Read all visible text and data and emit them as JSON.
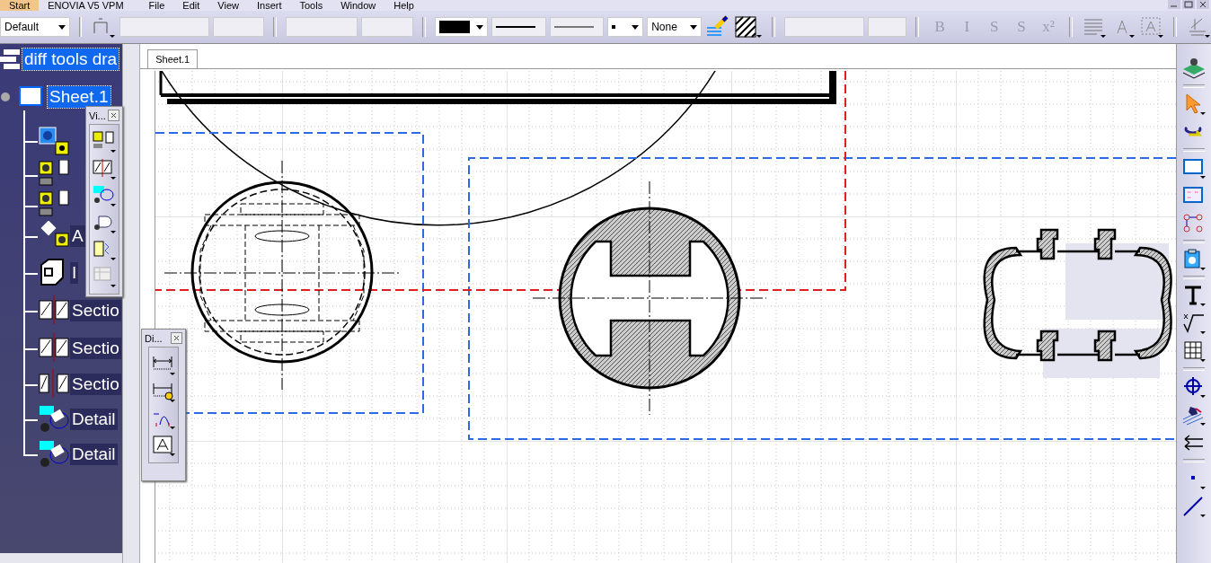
{
  "menu_bar": [
    {
      "label": "Start",
      "selected": true
    },
    {
      "label": "ENOVIA V5 VPM",
      "selected": false
    },
    {
      "label": "File",
      "selected": false
    },
    {
      "label": "Edit",
      "selected": false
    },
    {
      "label": "View",
      "selected": false
    },
    {
      "label": "Insert",
      "selected": false
    },
    {
      "label": "Tools",
      "selected": false
    },
    {
      "label": "Window",
      "selected": false
    },
    {
      "label": "Help",
      "selected": false
    }
  ],
  "toolbar": {
    "style": "Default",
    "fill": "None",
    "text_buttons": [
      {
        "label": "B",
        "disabled": true
      },
      {
        "label": "I",
        "disabled": true
      },
      {
        "label": "S",
        "disabled": true
      },
      {
        "label": "S",
        "disabled": true
      },
      {
        "label": "x²",
        "disabled": true
      }
    ]
  },
  "tree": {
    "label": "diff tools dra",
    "selected": true,
    "children": [
      {
        "label": "Sheet.1",
        "selected": true,
        "children": [
          {
            "kind": "front_view",
            "selected": false
          },
          {
            "kind": "view",
            "selected": false
          },
          {
            "kind": "view",
            "selected": false
          },
          {
            "kind": "auxiliary",
            "label": "A",
            "selected": false
          },
          {
            "kind": "isometric",
            "label": "I",
            "selected": false
          },
          {
            "kind": "section",
            "label": "Sectio",
            "selected": false
          },
          {
            "kind": "section",
            "label": "Sectio",
            "selected": false
          },
          {
            "kind": "section_cut",
            "label": "Sectio",
            "selected": false
          },
          {
            "kind": "detail",
            "label": "Detail",
            "selected": false
          },
          {
            "kind": "detail",
            "label": "Detail",
            "selected": false
          }
        ]
      }
    ]
  },
  "floating_toolbars": [
    {
      "title": "Vi..."
    },
    {
      "title": "Di..."
    }
  ],
  "tabs": [
    {
      "label": "Sheet.1",
      "selected": true
    }
  ]
}
